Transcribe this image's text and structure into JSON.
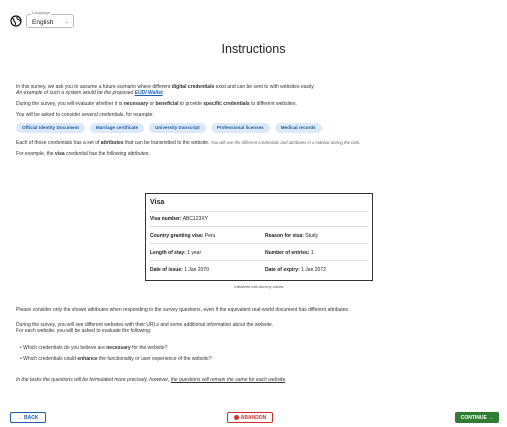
{
  "header": {
    "language_label": "Language",
    "language_value": "English"
  },
  "title": "Instructions",
  "intro": {
    "line1_pre": "In this survey, we ask you to assume a future scenario where different ",
    "line1_bold": "digital credentials",
    "line1_post": " exist and can be sent to with websites easily.",
    "line2_pre": "An example of such a system would be the proposed ",
    "line2_link": "EUDI Wallet",
    "line2_post": ".",
    "line3_pre": "During the survey, you will evaluate whether it is ",
    "line3_b1": "necessary",
    "line3_mid": " or ",
    "line3_b2": "beneficial",
    "line3_mid2": " to provide ",
    "line3_b3": "specific credentials",
    "line3_post": " to different websites.",
    "line4": "You will be asked to consider several credentials, for example:",
    "chips": [
      "Official Identity Document",
      "Marriage certificate",
      "University transcript",
      "Professional licenses",
      "Medical records"
    ],
    "line5_pre": "Each of those credentials has a set of ",
    "line5_bold": "attributes",
    "line5_post": " that can be transmitted to the website.",
    "line5_note": " You will see the different credentials and attributes in a sidebar during the task.",
    "line6_pre": "For example, the ",
    "line6_bold": "visa",
    "line6_post": " credential has the following attributes:"
  },
  "visa_card": {
    "title": "Visa",
    "visa_number_label": "Visa number:",
    "visa_number_value": "ABC123XY",
    "country_label": "Country granting visa:",
    "country_value": "Peru",
    "reason_label": "Reason for visa:",
    "reason_value": "Study",
    "length_label": "Length of stay:",
    "length_value": "1 year",
    "entries_label": "Number of entries:",
    "entries_value": "1",
    "issue_label": "Date of issue:",
    "issue_value": "1 Jan 2070",
    "expiry_label": "Date of expiry:",
    "expiry_value": "1 Jan 2072",
    "caption": "Initialized with dummy values"
  },
  "after": {
    "line1": "Please consider only the shown attributes when responding to the survey questions, even if the equivalent real-world document has different attributes.",
    "line2": "During the survey, you will see different websites with their URLs and some additional information about the website.",
    "line3": "For each website, you will be asked to evaluate the following:",
    "bullet1_pre": "Which credentials do you believe are ",
    "bullet1_bold": "necessary",
    "bullet1_post": " for the website?",
    "bullet2_pre": "Which credentials could ",
    "bullet2_bold": "enhance",
    "bullet2_post": " the functionality or user experience of the website?",
    "line4_pre": "In the tasks the questions will be formulated more precisely, however, ",
    "line4_u": "the questions will remain the same for each website",
    "line4_post": "."
  },
  "footer": {
    "back": "← BACK",
    "abandon": "ABANDON",
    "continue": "CONTINUE →"
  },
  "colors": {
    "accent": "#1a5fb4",
    "danger": "#d32f2f",
    "success": "#2e7d32",
    "chip_bg": "#dbe9fb"
  }
}
